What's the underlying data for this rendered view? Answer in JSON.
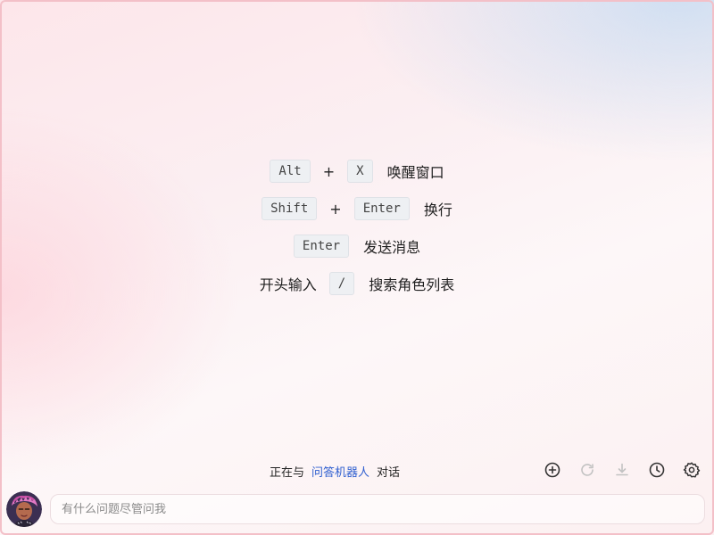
{
  "shortcuts": [
    {
      "keys": [
        "Alt",
        "X"
      ],
      "plus": "+",
      "desc": "唤醒窗口"
    },
    {
      "keys": [
        "Shift",
        "Enter"
      ],
      "plus": "+",
      "desc": "换行"
    },
    {
      "keys": [
        "Enter"
      ],
      "desc": "发送消息"
    },
    {
      "prefix": "开头输入",
      "keys": [
        "/"
      ],
      "desc": "搜索角色列表"
    }
  ],
  "status": {
    "prefix": "正在与",
    "bot_name": "问答机器人",
    "suffix": "对话"
  },
  "toolbar": {
    "icons": [
      "add-circle-icon",
      "refresh-icon",
      "download-icon",
      "history-icon",
      "settings-icon"
    ]
  },
  "input": {
    "placeholder": "有什么问题尽管问我",
    "value": ""
  },
  "colors": {
    "accent": "#2f5fd0",
    "key_bg": "#eef0f3",
    "frame_border": "#f3c0c8"
  }
}
